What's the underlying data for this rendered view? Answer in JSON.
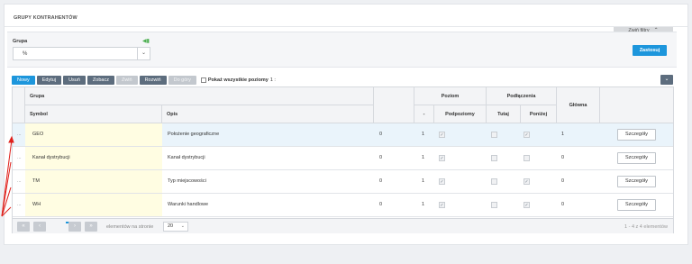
{
  "panel": {
    "title": "GRUPY KONTRAHENTÓW",
    "collapse_label": "Zwiń filtry"
  },
  "filter": {
    "label": "Grupa",
    "value": "%",
    "apply_label": "Zastosuj"
  },
  "toolbar": {
    "buttons": [
      "Nowy",
      "Edytuj",
      "Usuń",
      "Zobacz",
      "Zwiń",
      "Rozwiń",
      "Do góry"
    ],
    "show_all_label": "Pokaż wszystkie poziomy",
    "show_all_count": "1 :"
  },
  "headers": {
    "grupa": "Grupa",
    "symbol": "Symbol",
    "opis": "Opis",
    "poziom": "Poziom",
    "dash": "-",
    "podpoziomy": "Podpoziomy",
    "podlaczenia": "Podłączenia",
    "tutaj": "Tutaj",
    "ponizej": "Poniżej",
    "glowna": "Główna"
  },
  "rows": [
    {
      "dots": "...",
      "symbol": "GEO",
      "opis": "Położenie geograficzne",
      "col0": "0",
      "poziom": "1",
      "podpoziomy": true,
      "tutaj": false,
      "ponizej": true,
      "glowna": "1",
      "details": "Szczegóły"
    },
    {
      "dots": "...",
      "symbol": "Kanał dystrybucji",
      "opis": "Kanał dystrybucji",
      "col0": "0",
      "poziom": "1",
      "podpoziomy": true,
      "tutaj": false,
      "ponizej": false,
      "glowna": "0",
      "details": "Szczegóły"
    },
    {
      "dots": "...",
      "symbol": "TM",
      "opis": "Typ miejscowości",
      "col0": "0",
      "poziom": "1",
      "podpoziomy": true,
      "tutaj": false,
      "ponizej": true,
      "glowna": "0",
      "details": "Szczegóły"
    },
    {
      "dots": "...",
      "symbol": "WH",
      "opis": "Warunki handlowe",
      "col0": "0",
      "poziom": "1",
      "podpoziomy": true,
      "tutaj": false,
      "ponizej": true,
      "glowna": "0",
      "details": "Szczegóły"
    }
  ],
  "pager": {
    "page": "1",
    "per_page_label": "elementów na stronie",
    "per_page": "20",
    "info": "1 - 4 z 4 elementów"
  },
  "colors": {
    "accent": "#1d96dc",
    "button": "#5d6d7e",
    "highlight": "#fffde2",
    "annotation": "#e0201b"
  }
}
